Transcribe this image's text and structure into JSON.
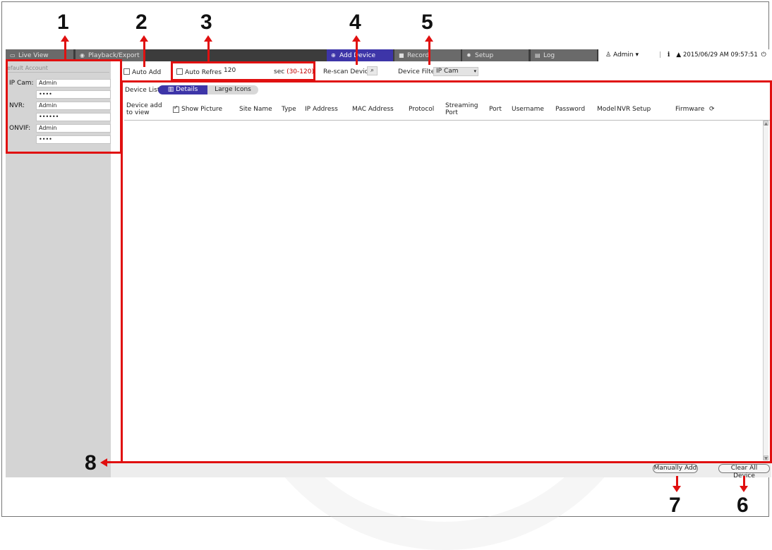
{
  "nav": {
    "tabs": [
      {
        "label": "Live View",
        "icon": "monitor-icon"
      },
      {
        "label": "Playback/Export",
        "icon": "play-circle-icon"
      },
      {
        "label": "Add Device",
        "icon": "plus-circle-icon"
      },
      {
        "label": "Record",
        "icon": "record-icon"
      },
      {
        "label": "Setup",
        "icon": "gear-icon"
      },
      {
        "label": "Log",
        "icon": "document-icon"
      }
    ],
    "user": "Admin",
    "info_glyph": "i",
    "datetime": "2015/06/29 AM 09:57:51"
  },
  "accounts": {
    "header": "efault Account",
    "rows": [
      {
        "label": "IP Cam:",
        "user": "Admin",
        "password": "••••"
      },
      {
        "label": "NVR:",
        "user": "Admin",
        "password": "••••••"
      },
      {
        "label": "ONVIF:",
        "user": "Admin",
        "password": "••••"
      }
    ]
  },
  "options": {
    "auto_add": "Auto Add",
    "auto_refresh": "Auto Refresh",
    "refresh_value": "120",
    "sec": "sec",
    "range": "(30-120)",
    "rescan": "Re-scan Device",
    "filter_label": "Device Filter",
    "filter_value": "IP Cam"
  },
  "device_list": {
    "label": "Device List",
    "view_details": "Details",
    "view_large_icons": "Large Icons",
    "columns": [
      "Device add to view",
      "Show Picture",
      "Site Name",
      "Type",
      "IP Address",
      "MAC Address",
      "Protocol",
      "Streaming Port",
      "Port",
      "Username",
      "Password",
      "Model",
      "NVR Setup",
      "Firmware"
    ]
  },
  "buttons": {
    "manually_add": "Manually Add",
    "clear_all": "Clear All Device"
  },
  "annotations": [
    "1",
    "2",
    "3",
    "4",
    "5",
    "6",
    "7",
    "8"
  ],
  "colors": {
    "accent": "#3d35a8",
    "annotation_red": "#e01010",
    "panel_gray": "#d4d4d4"
  }
}
